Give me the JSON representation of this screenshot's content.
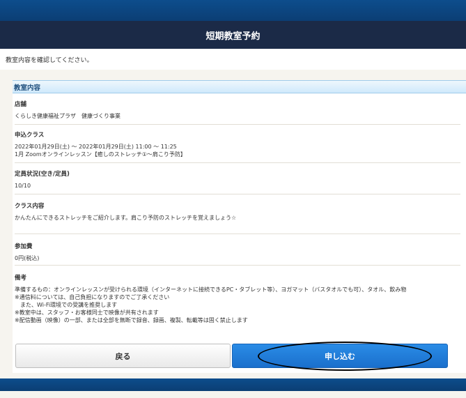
{
  "header": {
    "title": "短期教室予約"
  },
  "notice": "教室内容を確認してください。",
  "section": {
    "title": "教室内容",
    "fields": [
      {
        "label": "店舗",
        "lines": [
          "くらしき健康福祉プラザ　健康づくり事業"
        ]
      },
      {
        "label": "申込クラス",
        "lines": [
          "2022年01月29日(土) ～ 2022年01月29日(土) 11:00 ～ 11:25",
          "1月 Zoomオンラインレッスン【癒しのストレッチ①～肩こり予防】"
        ]
      },
      {
        "label": "定員状況(空き/定員)",
        "lines": [
          "10/10"
        ]
      },
      {
        "label": "クラス内容",
        "lines": [
          "かんたんにできるストレッチをご紹介します。肩こり予防のストレッチを覚えましょう☆"
        ]
      },
      {
        "label": "参加費",
        "lines": [
          "0円(税込)"
        ]
      },
      {
        "label": "備考",
        "lines": [
          "準備するもの：オンラインレッスンが受けられる環境（インターネットに接続できるPC・タブレット等）、ヨガマット（バスタオルでも可）、タオル、飲み物",
          "※通信料については、自己負担になりますのでご了承ください",
          "　また、Wi-Fi環境での受講を推奨します",
          "※教室中は、スタッフ・お客様同士で映像が共有されます",
          "※配信動画（映像）の一部、または全部を無断で録音、録画、複製、転載等は固く禁止します"
        ]
      }
    ]
  },
  "buttons": {
    "back": "戻る",
    "apply": "申し込む"
  },
  "colors": {
    "header_bg": "#1b2a47",
    "accent_blue": "#1a6fcc",
    "section_header": "#cfe9fb"
  }
}
